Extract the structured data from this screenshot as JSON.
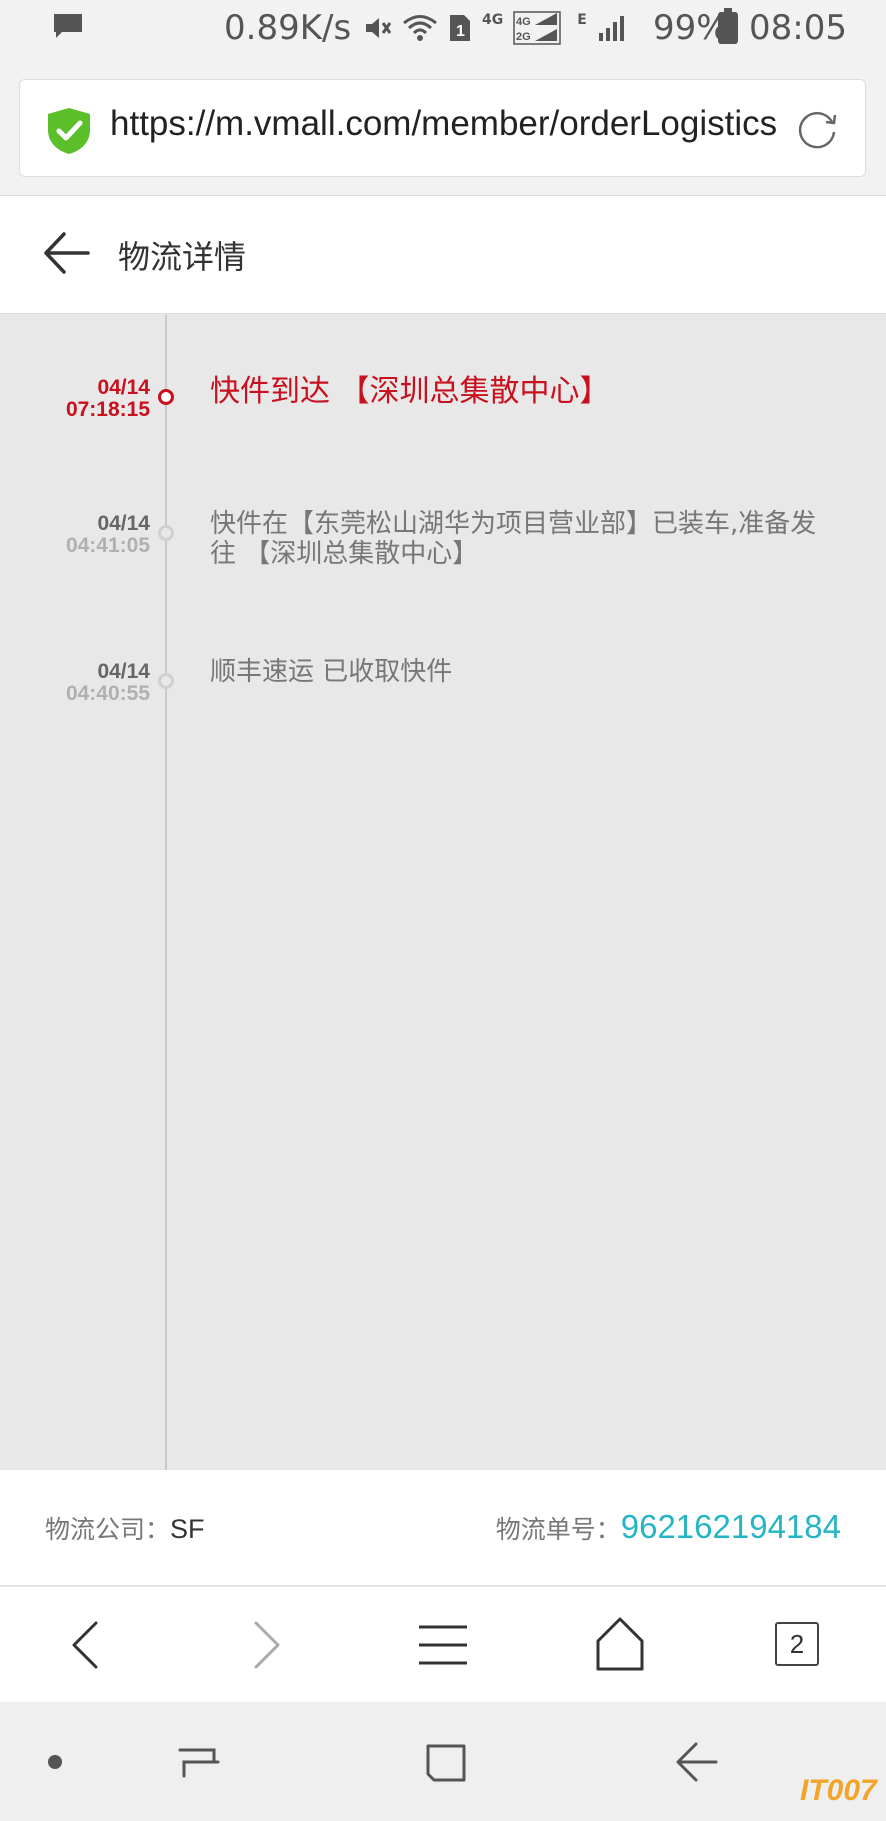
{
  "status_bar": {
    "network_speed": "0.89K/s",
    "sim_label": "1",
    "net_4g": "4G",
    "net_4g2g": "4G 2G",
    "net_e": "E",
    "battery": "99%",
    "time": "08:05",
    "icons": [
      "message-icon",
      "mute-icon",
      "wifi-icon",
      "sim-icon",
      "signal-icon",
      "signal-icon",
      "battery-icon"
    ]
  },
  "address_bar": {
    "url": "https://m.vmall.com/member/orderLogistics",
    "secure_color": "#5bbf2a"
  },
  "header": {
    "title": "物流详情"
  },
  "timeline": [
    {
      "date": "04/14",
      "time": "07:18:15",
      "text": "快件到达 【深圳总集散中心】",
      "active": true
    },
    {
      "date": "04/14",
      "time": "04:41:05",
      "text": "快件在【东莞松山湖华为项目营业部】已装车,准备发往 【深圳总集散中心】",
      "active": false
    },
    {
      "date": "04/14",
      "time": "04:40:55",
      "text": "顺丰速运 已收取快件",
      "active": false
    }
  ],
  "footer_info": {
    "company_label": "物流公司：",
    "company_value": "SF",
    "tracking_label": "物流单号：",
    "tracking_value": "962162194184"
  },
  "browser_toolbar": {
    "tab_count": "2"
  },
  "watermark": "IT007",
  "colors": {
    "accent_red": "#c8101e",
    "tracking_teal": "#26b5c4"
  }
}
